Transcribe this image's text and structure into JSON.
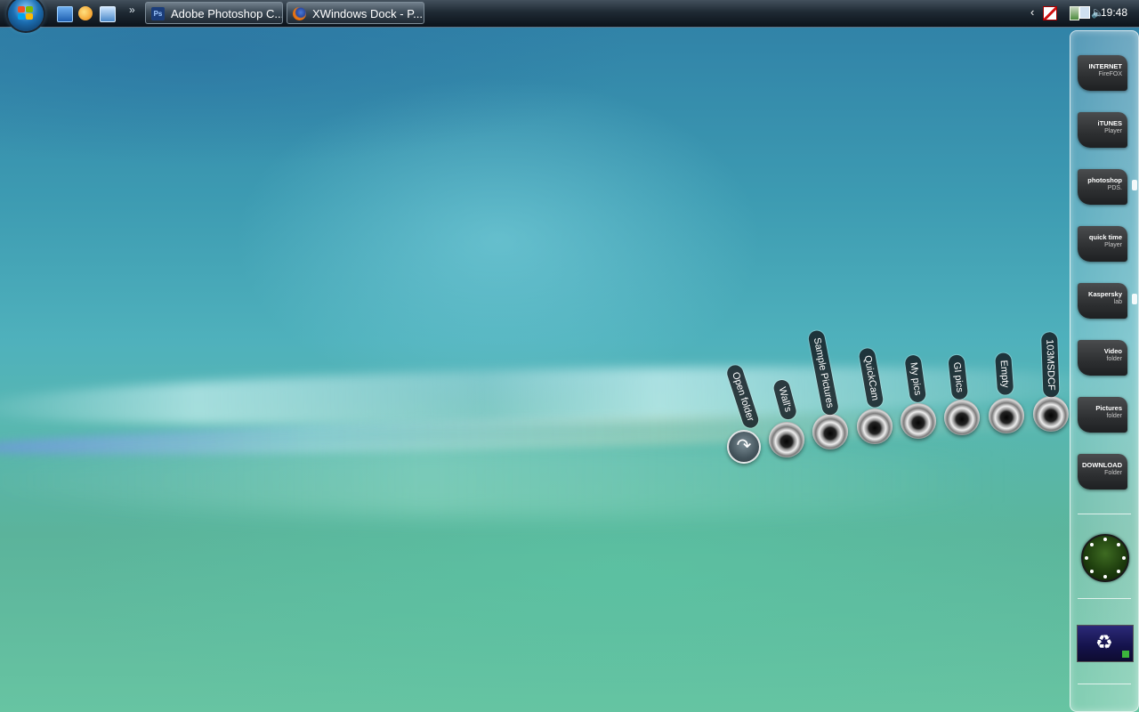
{
  "taskbar": {
    "quick_launch": [
      {
        "name": "show-desktop-icon",
        "color": "#2f6fc0"
      },
      {
        "name": "browser-icon",
        "color": "#f0a020"
      },
      {
        "name": "switch-windows-icon",
        "color": "#6aa8e0"
      }
    ],
    "overflow": "»",
    "tasks": [
      {
        "icon": "Ps",
        "label": "Adobe Photoshop C..."
      },
      {
        "icon": "firefox",
        "label": "XWindows Dock - P..."
      }
    ],
    "clock": "19:48"
  },
  "dock": {
    "items": [
      {
        "line1": "INTERNET",
        "line2": "FireFOX"
      },
      {
        "line1": "iTUNES",
        "line2": "Player"
      },
      {
        "line1": "photoshop",
        "line2": "PDS."
      },
      {
        "line1": "quick time",
        "line2": "Player"
      },
      {
        "line1": "Kaspersky",
        "line2": "lab"
      },
      {
        "line1": "Video",
        "line2": "folder"
      },
      {
        "line1": "Pictures",
        "line2": "folder"
      },
      {
        "line1": "DOWNLOAD",
        "line2": "Folder"
      }
    ]
  },
  "stack": {
    "open_label": "Open folder",
    "folders": [
      "Wall's",
      "Sample Pictures",
      "QuickCam",
      "My pics",
      "GI pics",
      "Empty",
      "103MSDCF"
    ]
  }
}
